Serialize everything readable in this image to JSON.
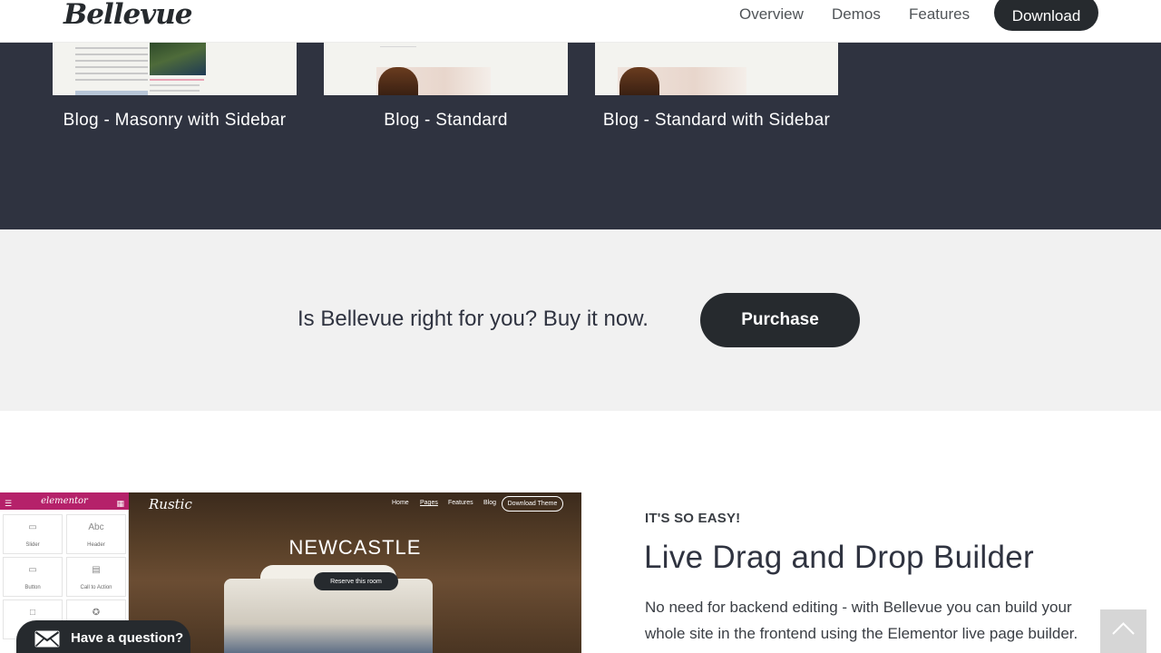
{
  "header": {
    "logo": "Bellevue",
    "nav": {
      "overview": "Overview",
      "demos": "Demos",
      "features": "Features"
    },
    "download_label": "Download"
  },
  "blog_demos": [
    {
      "label": "Blog - Masonry with Sidebar"
    },
    {
      "label": "Blog - Standard"
    },
    {
      "label": "Blog - Standard with Sidebar"
    }
  ],
  "cta": {
    "text": "Is Bellevue right for you? Buy it now.",
    "button_label": "Purchase"
  },
  "builder_preview": {
    "editor_brand": "elementor",
    "widgets": [
      "Slider",
      "Header",
      "Button",
      "Call to Action"
    ],
    "site_logo": "Rustic",
    "site_nav": [
      "Home",
      "Pages",
      "Features",
      "Blog"
    ],
    "site_nav_button": "Download Theme",
    "hero_title": "NEWCASTLE",
    "hero_button": "Reserve this room"
  },
  "builder": {
    "eyebrow": "IT'S SO EASY!",
    "title": "Live Drag and Drop Builder",
    "body": "No need for backend editing - with Bellevue you can build your whole site in the frontend using the Elementor live page builder."
  },
  "chat": {
    "label": "Have a question?"
  },
  "icons": {
    "chat": "envelope-icon",
    "scroll_top": "chevron-up-icon"
  },
  "colors": {
    "dark": "#262a2e",
    "dark_band": "#2f3340",
    "cta_bg": "#f1f1f1",
    "elementor": "#b5216a"
  }
}
